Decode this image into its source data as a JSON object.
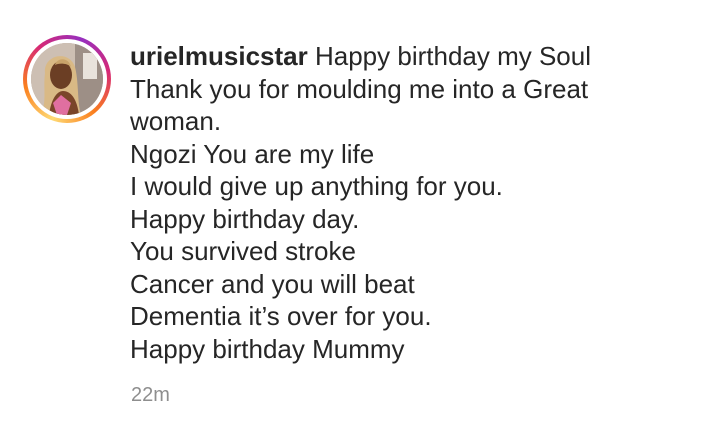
{
  "comment": {
    "username": "urielmusicstar",
    "lines": [
      "Happy birthday my Soul",
      "Thank you for moulding me into a Great",
      "woman.",
      "Ngozi You are my life",
      "I would give up anything for you.",
      "Happy birthday day.",
      "You survived stroke",
      "Cancer and you will beat",
      "Dementia it’s over for you.",
      "Happy birthday Mummy"
    ],
    "timestamp": "22m"
  },
  "avatar": {
    "icon": "profile-photo",
    "ring_colors": [
      "#feda75",
      "#fa7e1e",
      "#d62976",
      "#962fbf"
    ]
  },
  "colors": {
    "text": "#262626",
    "meta": "#8e8e8e",
    "background": "#ffffff"
  }
}
